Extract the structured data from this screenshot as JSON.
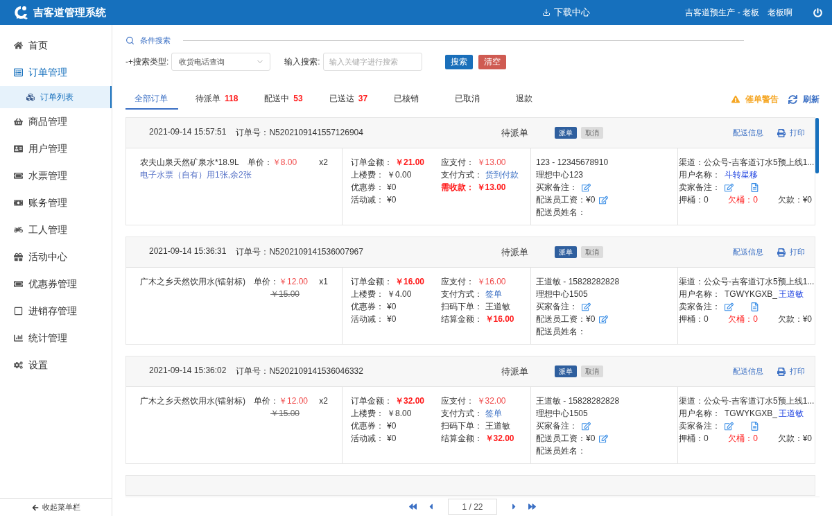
{
  "header": {
    "title": "吉客道管理系统",
    "download": "下载中心",
    "account": "吉客道预生产 - 老板",
    "user": "老板啊"
  },
  "sidebar": {
    "items": [
      {
        "label": "首页",
        "selected": false
      },
      {
        "label": "订单管理",
        "selected": true,
        "children": [
          {
            "label": "订单列表",
            "selected": true
          }
        ]
      },
      {
        "label": "商品管理",
        "selected": false
      },
      {
        "label": "用户管理",
        "selected": false
      },
      {
        "label": "水票管理",
        "selected": false
      },
      {
        "label": "账务管理",
        "selected": false
      },
      {
        "label": "工人管理",
        "selected": false
      },
      {
        "label": "活动中心",
        "selected": false
      },
      {
        "label": "优惠券管理",
        "selected": false
      },
      {
        "label": "进销存管理",
        "selected": false
      },
      {
        "label": "统计管理",
        "selected": false
      },
      {
        "label": "设置",
        "selected": false
      }
    ],
    "collapse": "收起菜单栏"
  },
  "search": {
    "title": "条件搜索",
    "type_label": "-+搜索类型:",
    "type_value": "收货电话查询",
    "input_label": "输入搜索:",
    "placeholder": "输入关键字进行搜索",
    "search_button": "搜索",
    "clear_button": "清空"
  },
  "tabs": [
    {
      "label": "全部订单",
      "selected": true
    },
    {
      "label": "待派单",
      "count": "118",
      "selected": false
    },
    {
      "label": "配送中",
      "count": "53",
      "selected": false
    },
    {
      "label": "已送达",
      "count": "37",
      "selected": false
    },
    {
      "label": "已核销",
      "selected": false
    },
    {
      "label": "已取消",
      "selected": false
    },
    {
      "label": "退款",
      "selected": false
    }
  ],
  "actions": {
    "warning": "催单警告",
    "refresh": "刷新"
  },
  "orders": [
    {
      "time": "2021-09-14 15:57:51",
      "order_no_label": "订单号：",
      "order_no": "N5202109141557126904",
      "status": "待派单",
      "dispatch": "派单",
      "cancel": "取消",
      "cancel_disabled": true,
      "delivery_info": "配送信息",
      "print": "打印",
      "item": {
        "name": "农夫山泉天然矿泉水*18.9L",
        "price_label": "单价：",
        "price": "￥8.00",
        "qty": "x2",
        "note": "电子水票（自有）用1张,余2张"
      },
      "money": [
        [
          {
            "label": "订单金额：",
            "value": "￥21.00",
            "kind": "amount"
          },
          {
            "label": "上楼费：",
            "value": "￥0.00",
            "kind": "plain"
          },
          {
            "label": "优惠券：",
            "value": "¥0",
            "kind": "plain"
          },
          {
            "label": "活动减：",
            "value": "¥0",
            "kind": "plain"
          }
        ],
        [
          {
            "label": "应支付：",
            "value": "￥13.00",
            "kind": "price"
          },
          {
            "label": "支付方式：",
            "value": "货到付款",
            "kind": "link"
          },
          {
            "label": "需收款：",
            "value": "￥13.00",
            "kind": "alert"
          }
        ]
      ],
      "contact": {
        "name_phone": "123 - 12345678910",
        "address": "理想中心123",
        "buyer_note": "买家备注：",
        "wage_label": "配送员工资：",
        "wage": "¥0",
        "driver_label": "配送员姓名："
      },
      "customer": {
        "channel": "渠道：公众号-吉客道订水5预上线1...",
        "user_label": "用户名称：",
        "user": "斗转星移",
        "seller_note": "卖家备注：",
        "deposit": "押桶：0",
        "owed_buckets": "欠桶：0",
        "owed": "欠款：¥0"
      }
    },
    {
      "time": "2021-09-14 15:36:31",
      "order_no_label": "订单号：",
      "order_no": "N5202109141536007967",
      "status": "待派单",
      "dispatch": "派单",
      "cancel": "取消",
      "cancel_disabled": true,
      "delivery_info": "配送信息",
      "print": "打印",
      "item": {
        "name": "广木之乡天然饮用水(镭射标)",
        "price_label": "单价：",
        "price": "￥12.00",
        "original_price": "￥15.00",
        "qty": "x1"
      },
      "money": [
        [
          {
            "label": "订单金额：",
            "value": "￥16.00",
            "kind": "amount"
          },
          {
            "label": "上楼费：",
            "value": "￥4.00",
            "kind": "plain"
          },
          {
            "label": "优惠券：",
            "value": "¥0",
            "kind": "plain"
          },
          {
            "label": "活动减：",
            "value": "¥0",
            "kind": "plain"
          }
        ],
        [
          {
            "label": "应支付：",
            "value": "￥16.00",
            "kind": "price"
          },
          {
            "label": "支付方式：",
            "value": "签单",
            "kind": "link"
          },
          {
            "label": "扫码下单：",
            "value": "王道敏",
            "kind": "plain"
          },
          {
            "label": "结算金额：",
            "value": "￥16.00",
            "kind": "amount"
          }
        ]
      ],
      "contact": {
        "name_phone": "王道敏 - 15828282828",
        "address": "理想中心1505",
        "buyer_note": "买家备注：",
        "wage_label": "配送员工资：",
        "wage": "¥0",
        "driver_label": "配送员姓名："
      },
      "customer": {
        "channel": "渠道：公众号-吉客道订水5预上线1...",
        "user_label": "用户名称：",
        "user_id": "TGWYKGXB_",
        "user": "王道敏",
        "seller_note": "卖家备注：",
        "deposit": "押桶：0",
        "owed_buckets": "欠桶：0",
        "owed": "欠款：¥0"
      }
    },
    {
      "time": "2021-09-14 15:36:02",
      "order_no_label": "订单号：",
      "order_no": "N5202109141536046332",
      "status": "待派单",
      "dispatch": "派单",
      "cancel": "取消",
      "cancel_disabled": true,
      "delivery_info": "配送信息",
      "print": "打印",
      "item": {
        "name": "广木之乡天然饮用水(镭射标)",
        "price_label": "单价：",
        "price": "￥12.00",
        "original_price": "￥15.00",
        "qty": "x2"
      },
      "money": [
        [
          {
            "label": "订单金额：",
            "value": "￥32.00",
            "kind": "amount"
          },
          {
            "label": "上楼费：",
            "value": "￥8.00",
            "kind": "plain"
          },
          {
            "label": "优惠券：",
            "value": "¥0",
            "kind": "plain"
          },
          {
            "label": "活动减：",
            "value": "¥0",
            "kind": "plain"
          }
        ],
        [
          {
            "label": "应支付：",
            "value": "￥32.00",
            "kind": "price"
          },
          {
            "label": "支付方式：",
            "value": "签单",
            "kind": "link"
          },
          {
            "label": "扫码下单：",
            "value": "王道敏",
            "kind": "plain"
          },
          {
            "label": "结算金额：",
            "value": "￥32.00",
            "kind": "amount"
          }
        ]
      ],
      "contact": {
        "name_phone": "王道敏 - 15828282828",
        "address": "理想中心1505",
        "buyer_note": "买家备注：",
        "wage_label": "配送员工资：",
        "wage": "¥0",
        "driver_label": "配送员姓名："
      },
      "customer": {
        "channel": "渠道：公众号-吉客道订水5预上线1...",
        "user_label": "用户名称：",
        "user_id": "TGWYKGXB_",
        "user": "王道敏",
        "seller_note": "卖家备注：",
        "deposit": "押桶：0",
        "owed_buckets": "欠桶：0",
        "owed": "欠款：¥0"
      }
    }
  ],
  "pagination": {
    "page": "1 / 22"
  }
}
